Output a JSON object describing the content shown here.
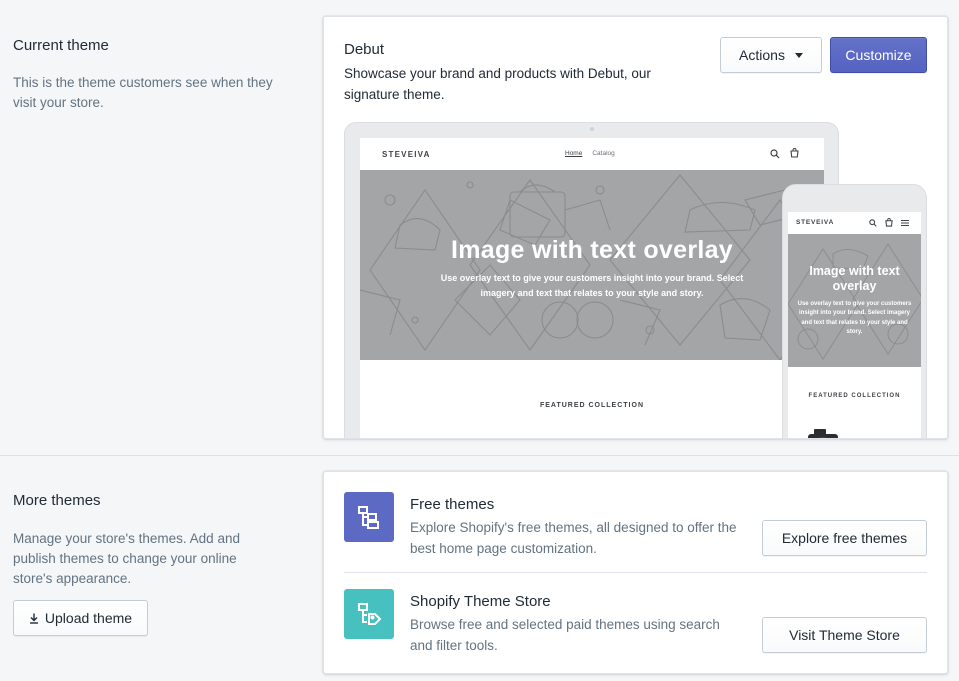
{
  "current_theme": {
    "section_title": "Current theme",
    "section_desc": "This is the theme customers see when they visit your store.",
    "theme_name": "Debut",
    "theme_desc": "Showcase your brand and products with Debut, our signature theme.",
    "actions_label": "Actions",
    "customize_label": "Customize",
    "preview": {
      "store_name": "STEVEIVA",
      "nav_home": "Home",
      "nav_catalog": "Catalog",
      "hero_title": "Image with text overlay",
      "hero_text": "Use overlay text to give your customers insight into your brand. Select imagery and text that relates to your style and story.",
      "featured_label": "FEATURED COLLECTION"
    }
  },
  "more_themes": {
    "section_title": "More themes",
    "section_desc": "Manage your store's themes. Add and publish themes to change your online store's appearance.",
    "upload_label": "Upload theme",
    "free": {
      "title": "Free themes",
      "desc": "Explore Shopify's free themes, all designed to offer the best home page customization.",
      "button": "Explore free themes",
      "icon": "theme-tree-icon",
      "color": "#5c6ac4"
    },
    "store": {
      "title": "Shopify Theme Store",
      "desc": "Browse free and selected paid themes using search and filter tools.",
      "button": "Visit Theme Store",
      "icon": "theme-store-icon",
      "color": "#47c1bf"
    }
  },
  "colors": {
    "primary": "#5c6ac4",
    "background": "#f4f6f8",
    "hero_gray": "#a3a5a6"
  }
}
